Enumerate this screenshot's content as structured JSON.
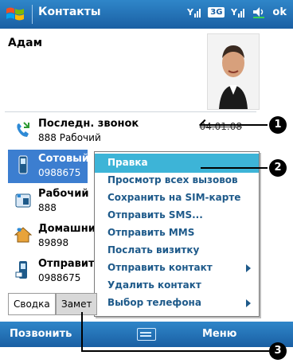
{
  "title_bar": {
    "app_title": "Контакты",
    "network_badge": "3G",
    "ok_label": "ok",
    "icons": [
      "windows-start-icon",
      "signal-icon",
      "3g-icon",
      "signal-icon",
      "volume-icon"
    ]
  },
  "contact": {
    "name": "Адам",
    "photo": "contact-photo"
  },
  "rows": [
    {
      "id": "last-call",
      "title": "Последн. звонок",
      "subtitle": "888 Рабочий",
      "date": "04.01.08",
      "icon": "phone-call-icon"
    },
    {
      "id": "mobile",
      "title": "Сотовый",
      "subtitle": "0988675",
      "icon": "mobile-phone-icon",
      "selected": true
    },
    {
      "id": "work",
      "title": "Рабочий",
      "subtitle": "888",
      "icon": "work-phone-icon"
    },
    {
      "id": "home",
      "title": "Домашни",
      "subtitle": "89898",
      "icon": "home-phone-icon"
    },
    {
      "id": "send",
      "title": "Отправит",
      "subtitle": "0988675",
      "icon": "send-sms-icon"
    }
  ],
  "context_menu": {
    "items": [
      {
        "label": "Правка",
        "active": true
      },
      {
        "label": "Просмотр всех вызовов"
      },
      {
        "label": "Сохранить на SIM-карте"
      },
      {
        "label": "Отправить SMS..."
      },
      {
        "label": "Отправить MMS"
      },
      {
        "label": "Послать визитку"
      },
      {
        "label": "Отправить контакт",
        "submenu": true
      },
      {
        "label": "Удалить контакт"
      },
      {
        "label": "Выбор телефона",
        "submenu": true
      }
    ]
  },
  "tabs": [
    {
      "label": "Сводка",
      "active": true
    },
    {
      "label": "Замет"
    }
  ],
  "softkeys": {
    "left": "Позвонить",
    "right": "Меню"
  },
  "callouts": [
    "1",
    "2",
    "3"
  ],
  "colors": {
    "bar": "#1a5fa3",
    "selection": "#3c7ed0",
    "menu_active": "#3db4d7",
    "menu_text": "#1e5a8a"
  }
}
